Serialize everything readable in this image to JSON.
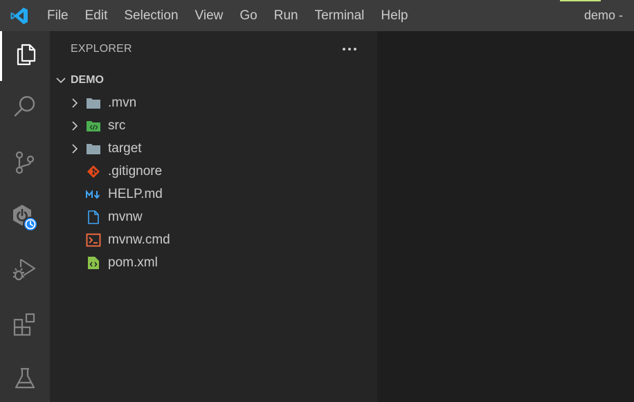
{
  "titlebar": {
    "app_icon": "vscode-logo-icon",
    "title": "demo -",
    "accent_color": "#c5e478",
    "menu": [
      "File",
      "Edit",
      "Selection",
      "View",
      "Go",
      "Run",
      "Terminal",
      "Help"
    ]
  },
  "activitybar": {
    "items": [
      {
        "icon": "explorer-files-icon",
        "active": true
      },
      {
        "icon": "search-icon",
        "active": false
      },
      {
        "icon": "source-control-icon",
        "active": false
      },
      {
        "icon": "spring-boot-dashboard-icon",
        "active": false
      },
      {
        "icon": "run-debug-icon",
        "active": false
      },
      {
        "icon": "extensions-icon",
        "active": false
      },
      {
        "icon": "testing-flask-icon",
        "active": false
      }
    ]
  },
  "sidebar": {
    "header": "EXPLORER",
    "more_actions_icon": "ellipsis-icon",
    "section": {
      "title": "DEMO",
      "expanded": true
    },
    "tree": [
      {
        "label": ".mvn",
        "type": "folder",
        "icon": "folder-icon",
        "collapsed": true
      },
      {
        "label": "src",
        "type": "folder",
        "icon": "src-folder-icon",
        "collapsed": true
      },
      {
        "label": "target",
        "type": "folder",
        "icon": "folder-icon",
        "collapsed": true
      },
      {
        "label": ".gitignore",
        "type": "file",
        "icon": "git-file-icon"
      },
      {
        "label": "HELP.md",
        "type": "file",
        "icon": "markdown-file-icon"
      },
      {
        "label": "mvnw",
        "type": "file",
        "icon": "file-icon"
      },
      {
        "label": "mvnw.cmd",
        "type": "file",
        "icon": "terminal-file-icon"
      },
      {
        "label": "pom.xml",
        "type": "file",
        "icon": "xml-file-icon"
      }
    ]
  },
  "colors": {
    "titlebar_bg": "#3c3c3c",
    "activitybar_bg": "#333333",
    "sidebar_bg": "#252526",
    "editor_bg": "#1e1e1e",
    "text": "#cccccc",
    "vscode_blue": "#23a9f2",
    "folder": "#90a4ae",
    "src_folder": "#4caf50",
    "git": "#e64a19",
    "markdown": "#42a5f5",
    "file_blue": "#42a5f5",
    "terminal": "#ff7043",
    "xml": "#8bc34a"
  }
}
